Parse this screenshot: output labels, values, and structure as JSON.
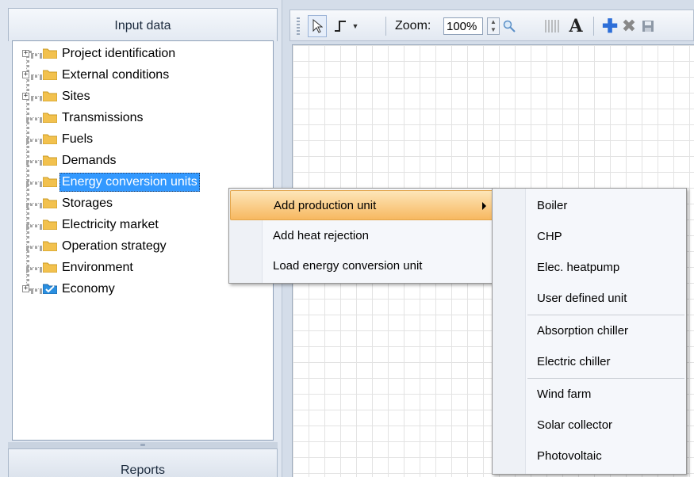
{
  "left_panel": {
    "title": "Input data",
    "reports_title": "Reports",
    "tree": [
      {
        "label": "Project identification",
        "expandable": true,
        "icon": "folder-icon"
      },
      {
        "label": "External conditions",
        "expandable": true,
        "icon": "folder-icon"
      },
      {
        "label": "Sites",
        "expandable": true,
        "icon": "folder-icon"
      },
      {
        "label": "Transmissions",
        "expandable": false,
        "icon": "folder-icon"
      },
      {
        "label": "Fuels",
        "expandable": false,
        "icon": "folder-icon"
      },
      {
        "label": "Demands",
        "expandable": false,
        "icon": "folder-icon"
      },
      {
        "label": "Energy conversion units",
        "expandable": false,
        "icon": "folder-icon",
        "selected": true
      },
      {
        "label": "Storages",
        "expandable": false,
        "icon": "folder-icon"
      },
      {
        "label": "Electricity market",
        "expandable": false,
        "icon": "folder-icon"
      },
      {
        "label": "Operation strategy",
        "expandable": false,
        "icon": "folder-icon"
      },
      {
        "label": "Environment",
        "expandable": false,
        "icon": "folder-icon"
      },
      {
        "label": "Economy",
        "expandable": true,
        "icon": "folder-checked-icon"
      }
    ]
  },
  "toolbar": {
    "zoom_label": "Zoom:",
    "zoom_value": "100%",
    "icons": [
      "pointer-icon",
      "connector-icon",
      "dropdown-arrow-icon",
      "zoom-spin-icon",
      "magnifier-icon",
      "grid-lines-icon",
      "text-icon",
      "add-icon",
      "delete-icon",
      "save-icon"
    ]
  },
  "context_menu": {
    "items": [
      {
        "label": "Add production unit",
        "highlighted": true,
        "has_submenu": true
      },
      {
        "label": "Add heat rejection"
      },
      {
        "label": "Load energy conversion unit"
      }
    ]
  },
  "submenu": {
    "items": [
      "Boiler",
      "CHP",
      "Elec. heatpump",
      "User defined unit",
      "Absorption chiller",
      "Electric chiller",
      "Wind farm",
      "Solar collector",
      "Photovoltaic"
    ]
  },
  "colors": {
    "selection": "#3399ff",
    "menu_highlight": "#f7b860",
    "folder": "#f2c14e",
    "checked_folder": "#2a8fe0"
  }
}
